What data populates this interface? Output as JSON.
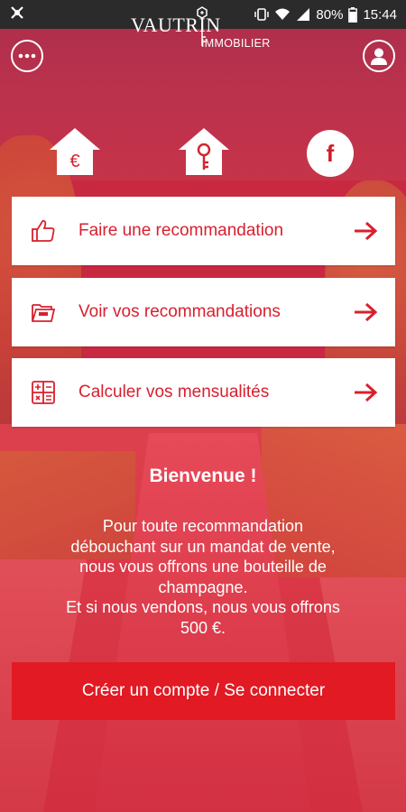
{
  "status_bar": {
    "battery": "80%",
    "time": "15:44"
  },
  "header": {
    "logo_main": "VAUTRIN",
    "logo_sub": "IMMOBILIER",
    "menu_icon": "more-dots-icon",
    "account_icon": "user-account-icon"
  },
  "shortcuts": {
    "items": [
      {
        "icon": "house-euro-icon"
      },
      {
        "icon": "house-key-icon"
      },
      {
        "icon": "facebook-icon",
        "label": "f"
      }
    ]
  },
  "actions": [
    {
      "label": "Faire une recommandation",
      "icon": "thumbs-up-icon"
    },
    {
      "label": "Voir vos recommandations",
      "icon": "open-folder-icon"
    },
    {
      "label": "Calculer vos mensualités",
      "icon": "calculator-icon"
    }
  ],
  "welcome": {
    "title": "Bienvenue !",
    "lines": [
      "Pour toute recommandation",
      "débouchant sur un mandat de vente,",
      "nous vous offrons une bouteille de",
      "champagne.",
      "Et si nous vendons, nous vous offrons",
      "500 €."
    ]
  },
  "cta": {
    "label": "Créer un compte / Se connecter"
  },
  "colors": {
    "accent": "#d8202e",
    "button": "#e11a24",
    "status_bar": "#2b2b2b"
  }
}
